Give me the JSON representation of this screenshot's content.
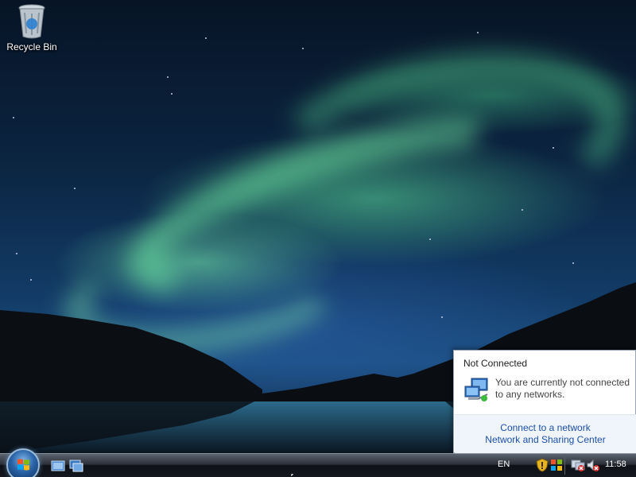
{
  "desktop": {
    "icons": [
      {
        "label": "Recycle Bin",
        "icon": "recycle-bin-icon"
      }
    ]
  },
  "taskbar": {
    "start_icon": "windows-start-orb-icon",
    "quick_launch": [
      {
        "icon": "show-desktop-icon"
      },
      {
        "icon": "switch-windows-icon"
      }
    ],
    "language": "EN",
    "tray_icons": [
      "windows-security-shield-icon",
      "security-center-icon",
      "network-disconnected-icon",
      "volume-muted-icon"
    ],
    "clock": "11:58"
  },
  "network_popup": {
    "title": "Not Connected",
    "message": "You are currently not connected to any networks.",
    "links": [
      "Connect to a network",
      "Network and Sharing Center"
    ],
    "link_color": "#1c4ea8"
  }
}
